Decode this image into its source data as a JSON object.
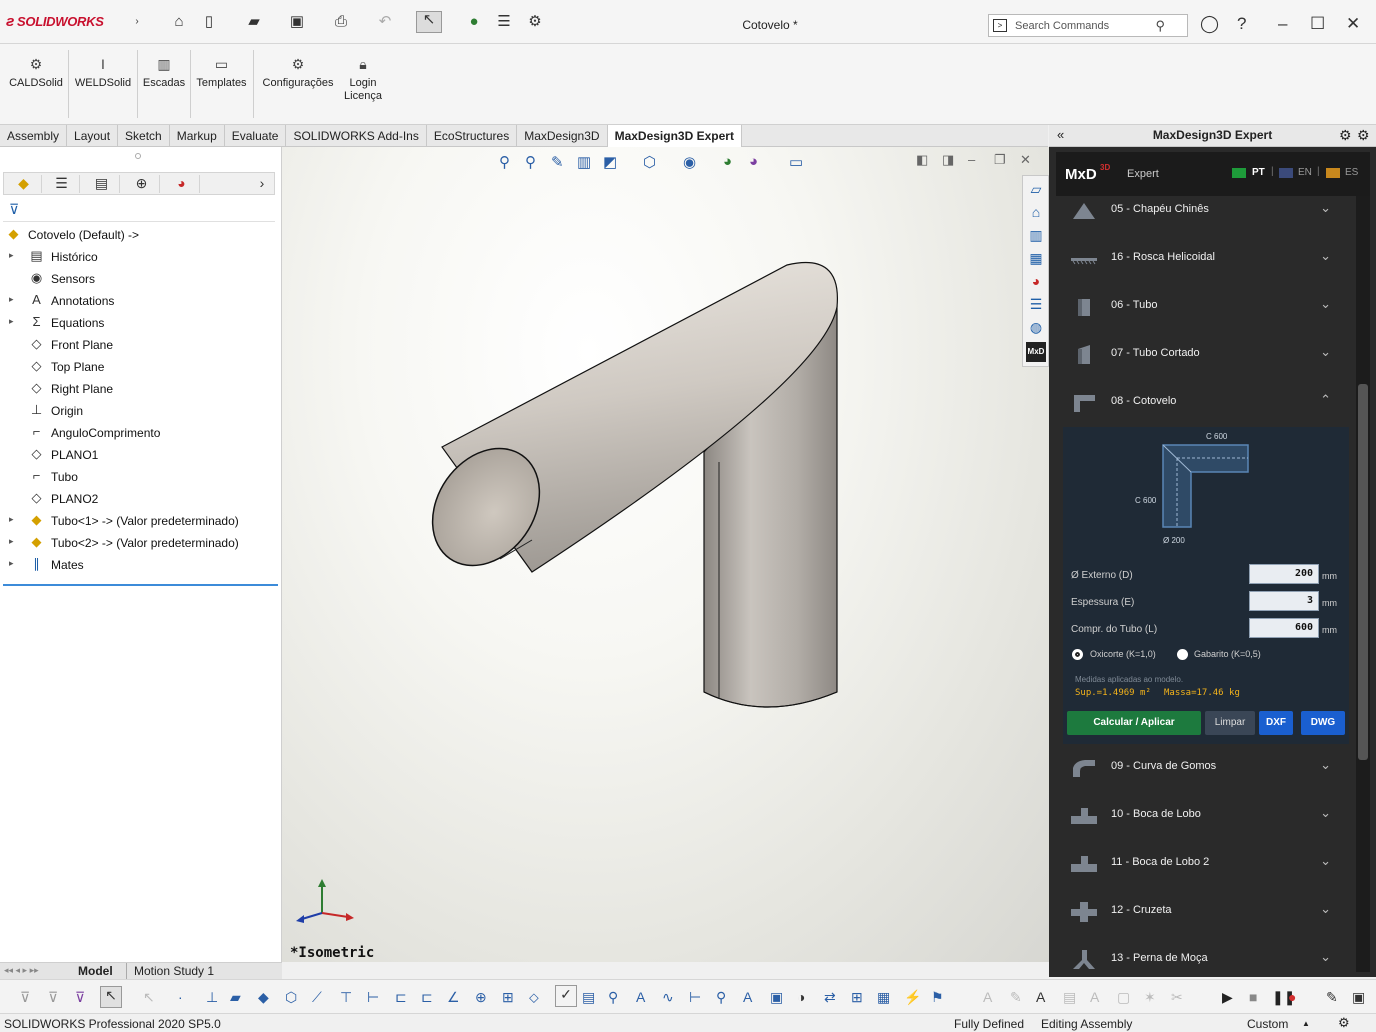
{
  "app": {
    "logo": "SOLIDWORKS",
    "document_title": "Cotovelo *",
    "search_placeholder": "Search Commands"
  },
  "ribbon": {
    "buttons": [
      {
        "label": "CALDSolid"
      },
      {
        "label": "WELDSolid"
      },
      {
        "label": "Escadas"
      },
      {
        "label": "Templates"
      },
      {
        "label": "Configurações"
      },
      {
        "label": "Login\nLicença"
      }
    ]
  },
  "tabs": [
    "Assembly",
    "Layout",
    "Sketch",
    "Markup",
    "Evaluate",
    "SOLIDWORKS Add-Ins",
    "EcoStructures",
    "MaxDesign3D",
    "MaxDesign3D Expert"
  ],
  "active_tab": "MaxDesign3D Expert",
  "tree": {
    "root": "Cotovelo  (Default) ->",
    "items": [
      {
        "label": "Histórico",
        "expandable": true,
        "icon": "history-folder-icon"
      },
      {
        "label": "Sensors",
        "expandable": false,
        "icon": "sensor-icon"
      },
      {
        "label": "Annotations",
        "expandable": true,
        "icon": "annotation-icon"
      },
      {
        "label": "Equations",
        "expandable": true,
        "icon": "equation-icon"
      },
      {
        "label": "Front Plane",
        "expandable": false,
        "icon": "plane-icon"
      },
      {
        "label": "Top Plane",
        "expandable": false,
        "icon": "plane-icon"
      },
      {
        "label": "Right Plane",
        "expandable": false,
        "icon": "plane-icon"
      },
      {
        "label": "Origin",
        "expandable": false,
        "icon": "origin-icon"
      },
      {
        "label": "AnguloComprimento",
        "expandable": false,
        "icon": "sketch-icon"
      },
      {
        "label": "PLANO1",
        "expandable": false,
        "icon": "plane-icon"
      },
      {
        "label": "Tubo",
        "expandable": false,
        "icon": "sketch-icon"
      },
      {
        "label": "PLANO2",
        "expandable": false,
        "icon": "plane-icon"
      },
      {
        "label": "Tubo<1> -> (Valor predeterminado)",
        "expandable": true,
        "icon": "part-icon"
      },
      {
        "label": "Tubo<2> -> (Valor predeterminado)",
        "expandable": true,
        "icon": "part-icon"
      },
      {
        "label": "Mates",
        "expandable": true,
        "icon": "mates-icon"
      }
    ]
  },
  "viewport": {
    "view_name": "*Isometric"
  },
  "right_panel": {
    "header": "MaxDesign3D Expert",
    "brand": "MxD",
    "brand_sup": "3D",
    "edition": "Expert",
    "languages": [
      "PT",
      "EN",
      "ES"
    ],
    "active_language": "PT",
    "items_top": [
      {
        "label": "05 - Chapéu Chinês",
        "icon": "cone-icon"
      },
      {
        "label": "16 - Rosca Helicoidal",
        "icon": "helix-icon"
      },
      {
        "label": "06 - Tubo",
        "icon": "tube-icon"
      },
      {
        "label": "07 - Tubo Cortado",
        "icon": "cut-tube-icon"
      },
      {
        "label": "08 - Cotovelo",
        "icon": "elbow-icon"
      }
    ],
    "cotovelo": {
      "diagram": {
        "top_dim": "C 600",
        "left_dim": "C 600",
        "dia_dim": "Ø 200"
      },
      "fields": [
        {
          "label": "Ø Externo (D)",
          "value": "200",
          "unit": "mm"
        },
        {
          "label": "Espessura (E)",
          "value": "3",
          "unit": "mm"
        },
        {
          "label": "Compr. do Tubo (L)",
          "value": "600",
          "unit": "mm"
        }
      ],
      "radio_options": [
        {
          "label": "Oxicorte (K=1,0)",
          "selected": true
        },
        {
          "label": "Gabarito (K=0,5)",
          "selected": false
        }
      ],
      "note": "Medidas aplicadas ao modelo.",
      "result_surface": "Sup.=1.4969 m²",
      "result_mass": "Massa=17.46 kg",
      "buttons": {
        "calc": "Calcular / Aplicar",
        "clear": "Limpar",
        "dxf": "DXF",
        "dwg": "DWG"
      }
    },
    "items_bottom": [
      {
        "label": "09 - Curva de Gomos",
        "icon": "segment-curve-icon"
      },
      {
        "label": "10 - Boca de Lobo",
        "icon": "tee-icon"
      },
      {
        "label": "11 - Boca de Lobo 2",
        "icon": "tee-icon"
      },
      {
        "label": "12 - Cruzeta",
        "icon": "cross-icon"
      },
      {
        "label": "13 - Perna de Moça",
        "icon": "wye-icon"
      }
    ],
    "accent": "#1d7a3e",
    "btn_blue": "#1a5fd0"
  },
  "model_tabs": [
    "Model",
    "Motion Study 1"
  ],
  "status": {
    "app_version": "SOLIDWORKS Professional 2020 SP5.0",
    "state": "Fully Defined",
    "mode": "Editing Assembly",
    "units": "Custom"
  }
}
